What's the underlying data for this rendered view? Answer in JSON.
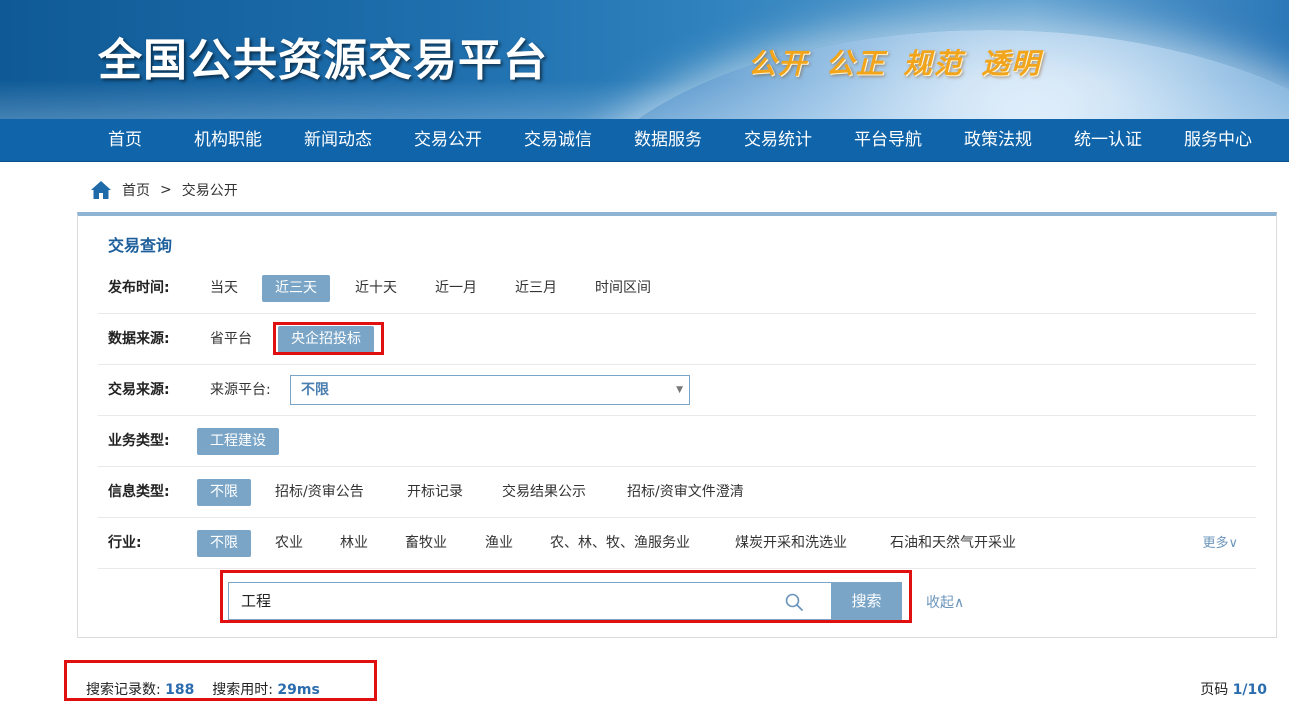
{
  "header": {
    "site_title": "全国公共资源交易平台",
    "slogan": "公开 公正 规范 透明"
  },
  "nav": {
    "items": [
      "首页",
      "机构职能",
      "新闻动态",
      "交易公开",
      "交易诚信",
      "数据服务",
      "交易统计",
      "平台导航",
      "政策法规",
      "统一认证",
      "服务中心"
    ]
  },
  "breadcrumb": {
    "home": "首页",
    "separator": ">",
    "current": "交易公开"
  },
  "query": {
    "title": "交易查询",
    "publish_time": {
      "label": "发布时间:",
      "options": [
        "当天",
        "近三天",
        "近十天",
        "近一月",
        "近三月",
        "时间区间"
      ],
      "selected": "近三天"
    },
    "data_source": {
      "label": "数据来源:",
      "options": [
        "省平台",
        "央企招投标"
      ],
      "selected": "央企招投标"
    },
    "trade_source": {
      "label": "交易来源:",
      "sub_label": "来源平台:",
      "value": "不限"
    },
    "business_type": {
      "label": "业务类型:",
      "options": [
        "工程建设"
      ],
      "selected": "工程建设"
    },
    "info_type": {
      "label": "信息类型:",
      "options": [
        "不限",
        "招标/资审公告",
        "开标记录",
        "交易结果公示",
        "招标/资审文件澄清"
      ],
      "selected": "不限"
    },
    "industry": {
      "label": "行业:",
      "options": [
        "不限",
        "农业",
        "林业",
        "畜牧业",
        "渔业",
        "农、林、牧、渔服务业",
        "煤炭开采和洗选业",
        "石油和天然气开采业"
      ],
      "selected": "不限",
      "more": "更多∨"
    },
    "search": {
      "value": "工程",
      "button": "搜索",
      "collapse": "收起∧"
    }
  },
  "results": {
    "count_label": "搜索记录数:",
    "count": "188",
    "time_label": "搜索用时:",
    "time": "29ms",
    "page_label": "页码",
    "page": "1/10"
  },
  "colors": {
    "nav_bg": "#0f64aa",
    "accent": "#7aa5c7",
    "highlight_box": "#e01010",
    "slogan": "#f2a51a"
  }
}
